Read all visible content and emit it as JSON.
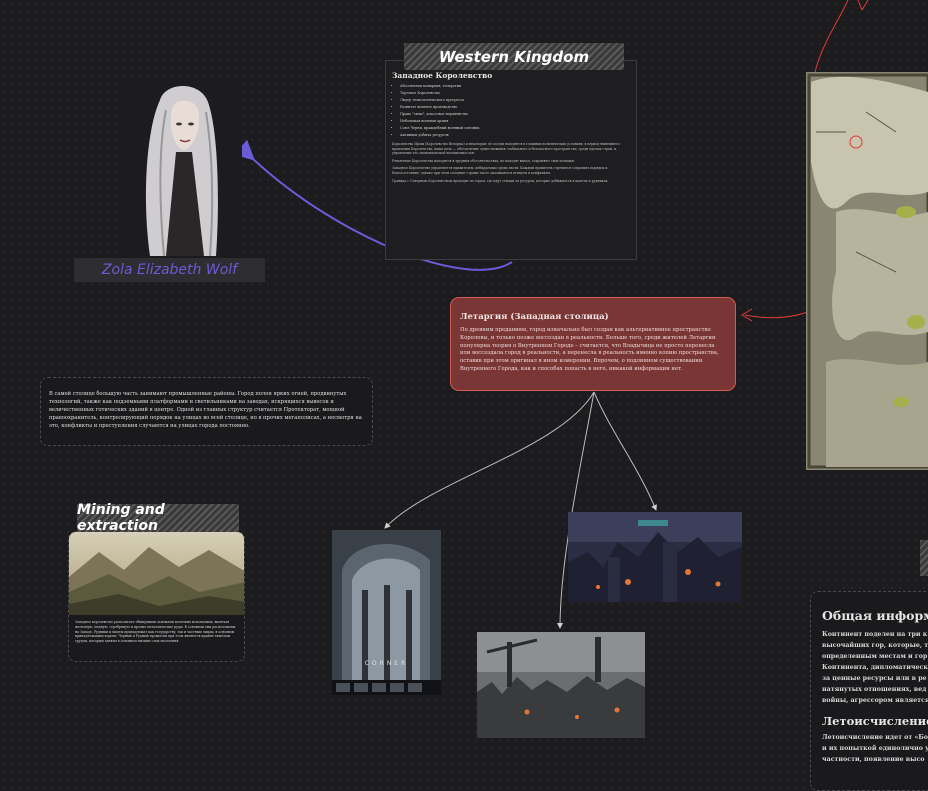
{
  "western": {
    "banner": "Western Kingdom",
    "doc_title": "Западное Королевство",
    "bullets": [
      "Абсолютная монархия, теократия",
      "Торговое Королевство",
      "Лидер технологического прогресса",
      "Развитое военное производство",
      "Право \"силы\", классовое неравенство",
      "Небольшая военная армия",
      "Союз Черни, враждебный военный союзник",
      "Активная добыча ресурсов"
    ],
    "paragraphs": [
      "Королевство Ирмы (Королевство Велорма) и некоторые её соседи находятся в сложных политических условиях; в период нынешнего правления Королевства, наша цель — обеспечение существования стабильного и безопасного пространства, среди прочих стран, и управление его экономической независимостью.",
      "Ремонтные Королевства находятся в трудных обстоятельствах, но находят выход, сохраняют свои позиции.",
      "Западное Королевство управляется правителем, избираемым среди знати. Каждый правитель стремится сохранить порядок и благосостояние; однако при этом соседние страны часто оказываются втянуты в конфликты.",
      "Граница с Северным Королевством проходит по горам, где идут стычки за ресурсы, которые добываются в шахтах и рудниках."
    ],
    "avatar_name": "Zola Elizabeth Wolf"
  },
  "capital": {
    "title": "Летаргия (Западная столица)",
    "text": "По древним преданиям, город изначально был создан как альтернативное пространство Королевы, и только позже воссоздан в реальности. Больше того, среди жителей Летаргии популярна теория о Внутреннем Городе – считается, что Владычица не просто перенесла или воссоздала город в реальности, а перенесла в реальность именно копию пространства, оставив при этом оригинал в ином измерении. Впрочем, о подлинном существовании Внутреннего Города, как и способах попасть в него, никакой информации нет."
  },
  "city_note": {
    "text": "В самой столице большую часть занимают промышленные районы. Город полон ярких огней, продвинутых технологий, также как подземными платформами и светильниками на заводах, искрящихся вывесок и величественных готических зданий в центре. Одной из главных структур считается Протекторат, мощной правоохранитель, контролирующий порядок на улицах во всей столице, но в прочих мегаполисах, а несмотря на это, конфликты и преступления случаются на улицах города постоянно."
  },
  "mining": {
    "banner": "Mining and extraction",
    "text": "Западное королевство располагает обширными залежами полезных ископаемых, включая железную, медную, серебряную и прочие металлические руды. В основном они расположены на Западе. Рудники и шахты принадлежат как государству, так и частным лицам, в основном принадлежащим короне. Черный и Рудный промыслы при этом являются крайне тяжёлым трудом, которым заняты в основном низшие слои населения."
  },
  "general": {
    "title": "Общая информация",
    "lines": [
      "Континент поделен на три к",
      "высочайших гор, которые, т",
      "определенным местам и гор",
      "Континента, дипломатическ",
      "за ценные ресурсы или в ре",
      "натянутых отношениях, вед",
      "войны, агрессором является"
    ],
    "subtitle": "Летоисчисление",
    "sub_lines": [
      "Летоисчисление идет от «Бо",
      "и их попыткой единолично у",
      "частности, появление высо"
    ]
  },
  "poster_caption": "CORNER",
  "colors": {
    "background": "#1c1b1d",
    "capital_card": "#7a3634",
    "capital_border": "#d35a55",
    "arrow_purple": "#6b5bd6",
    "arrow_red": "#e03b3b",
    "name_text": "#6b5bd6"
  }
}
